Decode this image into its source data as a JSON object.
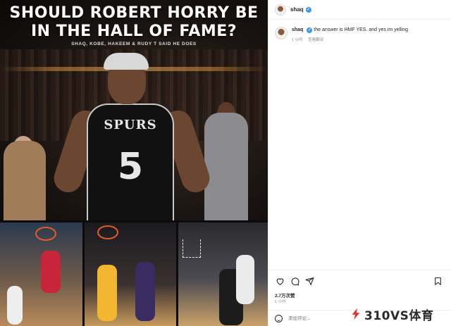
{
  "media": {
    "headline_line1": "SHOULD ROBERT HORRY BE",
    "headline_line2": "IN THE HALL OF FAME?",
    "subline": "SHAQ, KOBE, HAKEEM & RUDY T SAID HE DOES",
    "jersey_team": "SPURS",
    "jersey_number": "5"
  },
  "header": {
    "username": "shaq"
  },
  "caption": {
    "username": "shaq",
    "text": "the answer is HMF YES. and yes im yelling",
    "time": "1 小时",
    "translate": "查看翻译"
  },
  "actions": {
    "likes": "2.7万次赞",
    "time_ago": "1 小时"
  },
  "add_comment": {
    "placeholder": "添加评论..."
  },
  "watermark": {
    "text": "310VS体育"
  },
  "colors": {
    "verified": "#3897f0",
    "watermark_accent": "#e2322b"
  }
}
